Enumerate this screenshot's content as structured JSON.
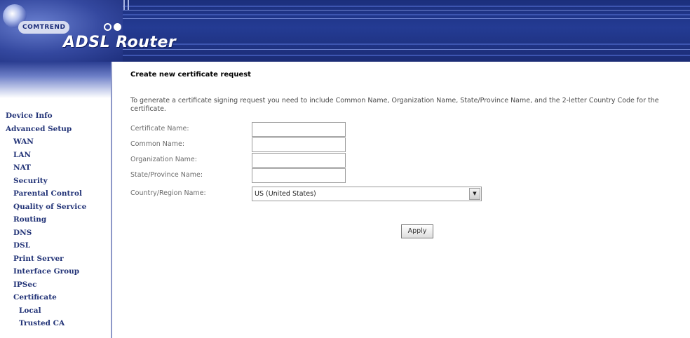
{
  "header": {
    "brand": "COMTREND",
    "product": "ADSL Router"
  },
  "sidebar": {
    "items": [
      {
        "label": "Device Info",
        "level": 0
      },
      {
        "label": "Advanced Setup",
        "level": 0
      },
      {
        "label": "WAN",
        "level": 1
      },
      {
        "label": "LAN",
        "level": 1
      },
      {
        "label": "NAT",
        "level": 1
      },
      {
        "label": "Security",
        "level": 1
      },
      {
        "label": "Parental Control",
        "level": 1
      },
      {
        "label": "Quality of Service",
        "level": 1
      },
      {
        "label": "Routing",
        "level": 1
      },
      {
        "label": "DNS",
        "level": 1
      },
      {
        "label": "DSL",
        "level": 1
      },
      {
        "label": "Print Server",
        "level": 1
      },
      {
        "label": "Interface Group",
        "level": 1
      },
      {
        "label": "IPSec",
        "level": 1
      },
      {
        "label": "Certificate",
        "level": 1
      },
      {
        "label": "Local",
        "level": 2
      },
      {
        "label": "Trusted CA",
        "level": 2
      }
    ]
  },
  "main": {
    "title": "Create new certificate request",
    "description": "To generate a certificate signing request you need to include Common Name, Organization Name, State/Province Name, and the 2-letter Country Code for the certificate.",
    "fields": {
      "certificate_name": {
        "label": "Certificate Name:",
        "value": ""
      },
      "common_name": {
        "label": "Common Name:",
        "value": ""
      },
      "organization_name": {
        "label": "Organization Name:",
        "value": ""
      },
      "state_province_name": {
        "label": "State/Province Name:",
        "value": ""
      },
      "country_region_name": {
        "label": "Country/Region Name:",
        "selected": "US (United States)"
      }
    },
    "apply_label": "Apply"
  },
  "colors": {
    "header_blue": "#243b93",
    "nav_text": "#223377",
    "sidebar_border": "#8d98c8"
  }
}
